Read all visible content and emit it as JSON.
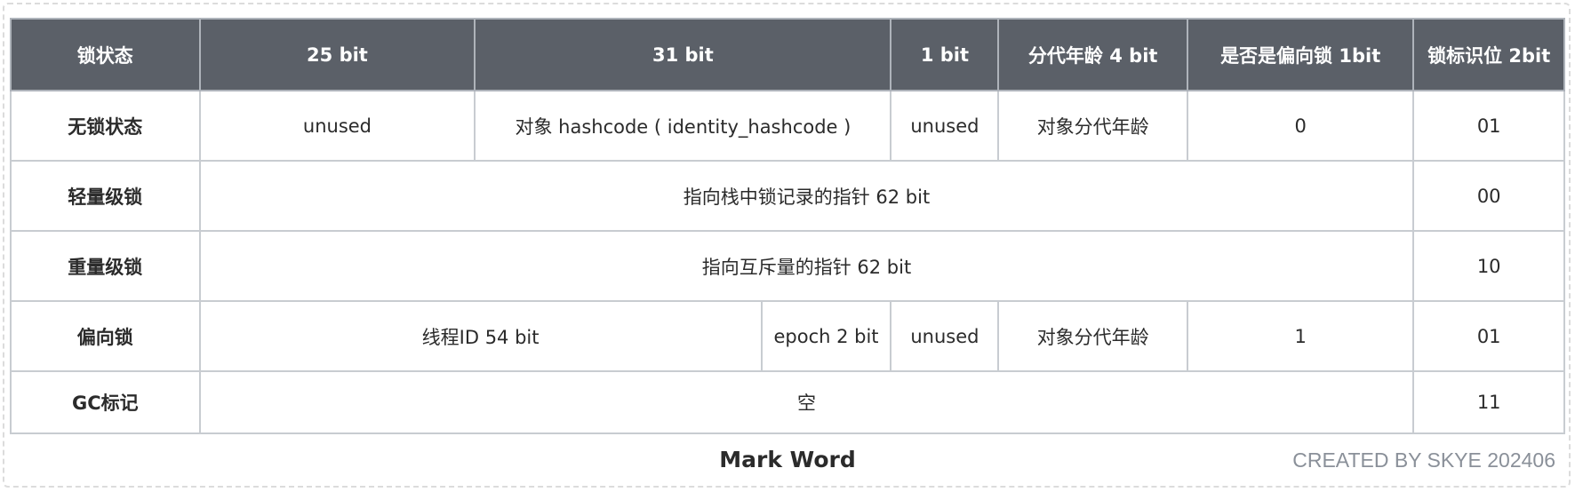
{
  "header": [
    "锁状态",
    "25 bit",
    "31 bit",
    "1 bit",
    "分代年龄 4 bit",
    "是否是偏向锁 1bit",
    "锁标识位 2bit"
  ],
  "rows": {
    "unlocked": {
      "label": "无锁状态",
      "c25": "unused",
      "c31": "对象 hashcode ( identity_hashcode )",
      "c1": "unused",
      "age": "对象分代年龄",
      "biased": "0",
      "flag": "01"
    },
    "lightweight": {
      "label": "轻量级锁",
      "span": "指向栈中锁记录的指针 62 bit",
      "flag": "00"
    },
    "heavyweight": {
      "label": "重量级锁",
      "span": "指向互斥量的指针 62 bit",
      "flag": "10"
    },
    "biased": {
      "label": "偏向锁",
      "thread": "线程ID 54 bit",
      "epoch": "epoch 2 bit",
      "c1": "unused",
      "age": "对象分代年龄",
      "biased": "1",
      "flag": "01"
    },
    "gc": {
      "label": "GC标记",
      "span": "空",
      "flag": "11"
    }
  },
  "caption": "Mark Word",
  "credit": "CREATED BY SKYE 202406"
}
